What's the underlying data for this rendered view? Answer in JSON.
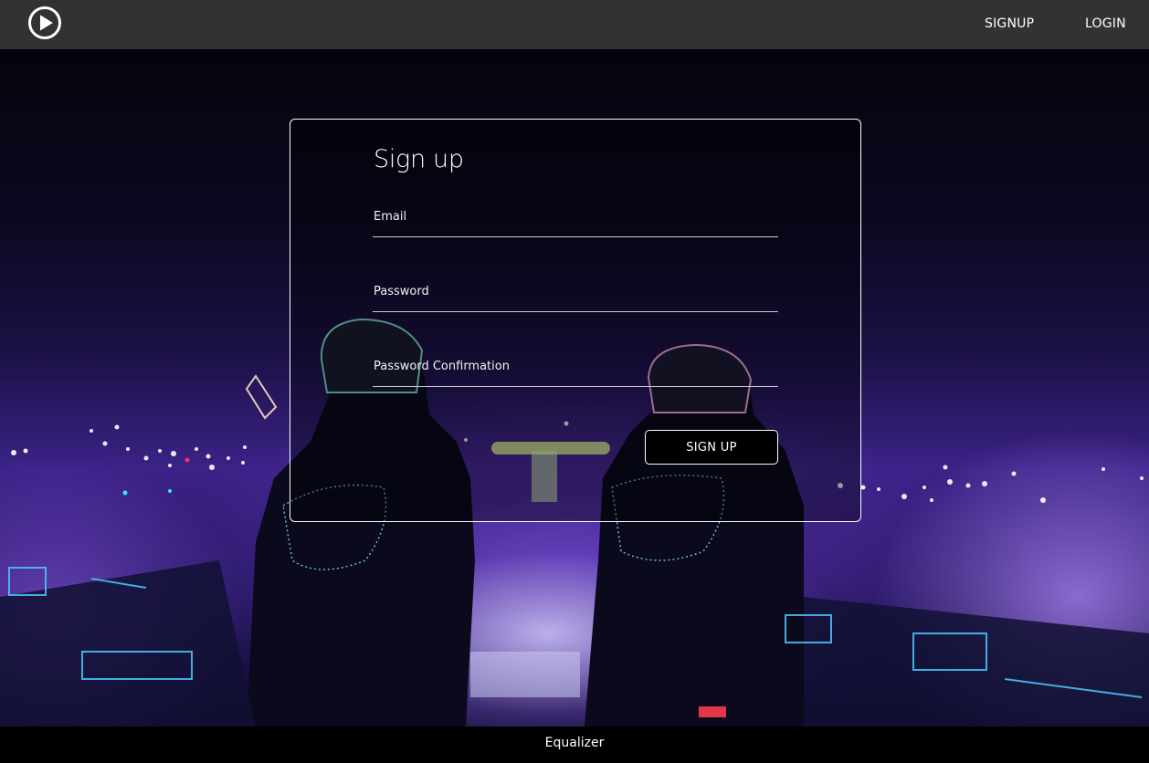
{
  "app": {
    "title": "Equalizer",
    "logo_icon": "play-circle-icon"
  },
  "nav": {
    "signup_label": "SIGNUP",
    "login_label": "LOGIN"
  },
  "form": {
    "title": "Sign up",
    "email_placeholder": "Email",
    "password_placeholder": "Password",
    "password_confirm_placeholder": "Password Confirmation",
    "submit_label": "SIGN UP"
  },
  "footer": {
    "text": "Equalizer"
  },
  "colors": {
    "topbar": "#323232",
    "footer": "#000000",
    "accent_purple": "#3b2287",
    "text": "#ffffff"
  }
}
